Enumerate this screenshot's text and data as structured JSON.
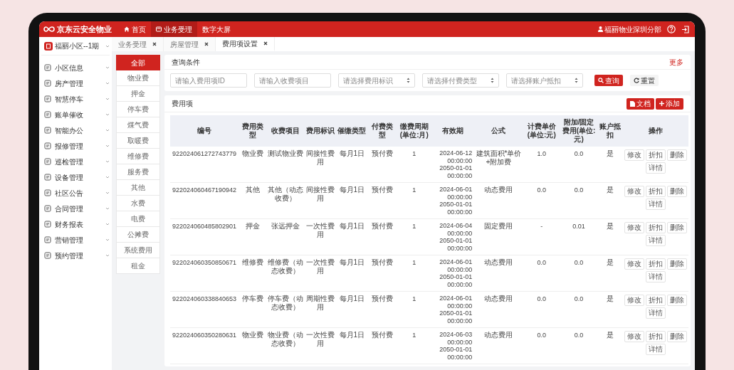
{
  "brand": "京东云安全物业",
  "topnav": [
    {
      "label": "首页",
      "selected": false,
      "kind": "home"
    },
    {
      "label": "业务受理",
      "selected": true,
      "kind": "card"
    },
    {
      "label": "数字大屏",
      "selected": false,
      "kind": "none"
    }
  ],
  "user": "福丽物业深圳分部",
  "community": "福丽小区--1期",
  "menu": [
    {
      "label": "小区信息"
    },
    {
      "label": "房产管理"
    },
    {
      "label": "智慧停车"
    },
    {
      "label": "账单催收"
    },
    {
      "label": "智能办公"
    },
    {
      "label": "报修管理"
    },
    {
      "label": "巡检管理"
    },
    {
      "label": "设备管理"
    },
    {
      "label": "社区公告"
    },
    {
      "label": "合同管理"
    },
    {
      "label": "财务报表"
    },
    {
      "label": "营销管理"
    },
    {
      "label": "预约管理"
    }
  ],
  "tabs": [
    {
      "label": "业务受理",
      "selected": false
    },
    {
      "label": "房屋管理",
      "selected": false
    },
    {
      "label": "费用项设置",
      "selected": true
    }
  ],
  "categories": [
    {
      "label": "全部",
      "selected": true
    },
    {
      "label": "物业费",
      "selected": false
    },
    {
      "label": "押金",
      "selected": false
    },
    {
      "label": "停车费",
      "selected": false
    },
    {
      "label": "煤气费",
      "selected": false
    },
    {
      "label": "取暖费",
      "selected": false
    },
    {
      "label": "维修费",
      "selected": false
    },
    {
      "label": "服务费",
      "selected": false
    },
    {
      "label": "其他",
      "selected": false
    },
    {
      "label": "水费",
      "selected": false
    },
    {
      "label": "电费",
      "selected": false
    },
    {
      "label": "公摊费",
      "selected": false
    },
    {
      "label": "系统费用",
      "selected": false
    },
    {
      "label": "租金",
      "selected": false
    }
  ],
  "query": {
    "title": "查询条件",
    "more": "更多",
    "fields": [
      {
        "kind": "input",
        "placeholder": "请输入费用项ID"
      },
      {
        "kind": "input",
        "placeholder": "请输入收费项目"
      },
      {
        "kind": "select",
        "placeholder": "请选择费用标识"
      },
      {
        "kind": "select",
        "placeholder": "请选择付费类型"
      },
      {
        "kind": "select",
        "placeholder": "请选择账户抵扣"
      }
    ],
    "search_button": "查询",
    "reset_button": "重置"
  },
  "fees": {
    "title": "费用项",
    "doc_button": "文档",
    "add_button": "添加",
    "table": {
      "columns": [
        "编号",
        "费用类型",
        "收费项目",
        "费用标识",
        "催缴类型",
        "付费类型",
        "缴费周期(单位:月)",
        "有效期",
        "公式",
        "计费单价(单位:元)",
        "附加/固定费用(单位:元)",
        "账户抵扣",
        "操作"
      ],
      "rows": [
        {
          "id": "922024061272743779",
          "type": "物业费",
          "item": "测试物业费",
          "flag": "间接性费用",
          "remind": "每月1日",
          "pay": "预付费",
          "cycle": "1",
          "valid_from": "2024-06-12 00:00:00",
          "valid_to": "2050-01-01 00:00:00",
          "formula": "建筑面积*单价+附加费",
          "price": "1.0",
          "extra": "0.0",
          "deduct": "是",
          "actions": [
            "修改",
            "折扣",
            "删除",
            "详情"
          ]
        },
        {
          "id": "922024060467190942",
          "type": "其他",
          "item": "其他（动态收费）",
          "flag": "间接性费用",
          "remind": "每月1日",
          "pay": "预付费",
          "cycle": "1",
          "valid_from": "2024-06-01 00:00:00",
          "valid_to": "2050-01-01 00:00:00",
          "formula": "动态费用",
          "price": "0.0",
          "extra": "0.0",
          "deduct": "是",
          "actions": [
            "修改",
            "折扣",
            "删除",
            "详情"
          ]
        },
        {
          "id": "922024060485802901",
          "type": "押金",
          "item": "张远押金",
          "flag": "一次性费用",
          "remind": "每月1日",
          "pay": "预付费",
          "cycle": "1",
          "valid_from": "2024-06-04 00:00:00",
          "valid_to": "2050-01-01 00:00:00",
          "formula": "固定费用",
          "price": "-",
          "extra": "0.01",
          "deduct": "是",
          "actions": [
            "修改",
            "折扣",
            "删除",
            "详情"
          ]
        },
        {
          "id": "922024060350850671",
          "type": "维修费",
          "item": "维修费（动态收费）",
          "flag": "一次性费用",
          "remind": "每月1日",
          "pay": "预付费",
          "cycle": "1",
          "valid_from": "2024-06-01 00:00:00",
          "valid_to": "2050-01-01 00:00:00",
          "formula": "动态费用",
          "price": "0.0",
          "extra": "0.0",
          "deduct": "是",
          "actions": [
            "修改",
            "折扣",
            "删除",
            "详情"
          ]
        },
        {
          "id": "922024060338840653",
          "type": "停车费",
          "item": "停车费（动态收费）",
          "flag": "周期性费用",
          "remind": "每月1日",
          "pay": "预付费",
          "cycle": "1",
          "valid_from": "2024-06-01 00:00:00",
          "valid_to": "2050-01-01 00:00:00",
          "formula": "动态费用",
          "price": "0.0",
          "extra": "0.0",
          "deduct": "是",
          "actions": [
            "修改",
            "折扣",
            "删除",
            "详情"
          ]
        },
        {
          "id": "922024060350280631",
          "type": "物业费",
          "item": "物业费（动态收费）",
          "flag": "一次性费用",
          "remind": "每月1日",
          "pay": "预付费",
          "cycle": "1",
          "valid_from": "2024-06-03 00:00:00",
          "valid_to": "2050-01-01 00:00:00",
          "formula": "动态费用",
          "price": "0.0",
          "extra": "0.0",
          "deduct": "是",
          "actions": [
            "修改",
            "折扣",
            "删除",
            "详情"
          ]
        }
      ]
    }
  }
}
